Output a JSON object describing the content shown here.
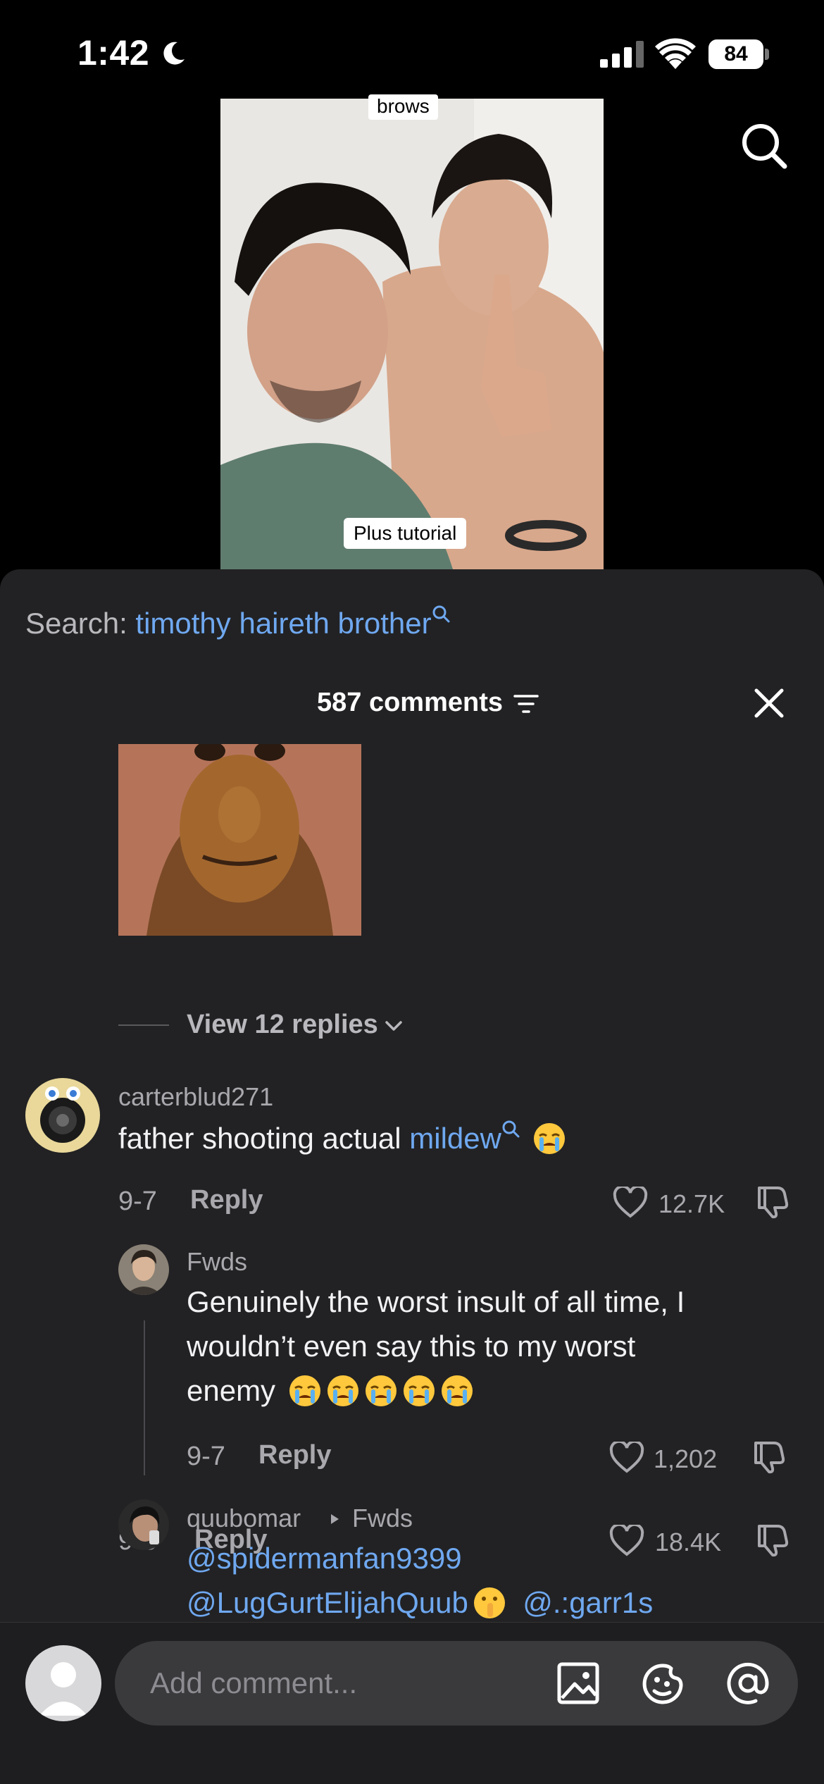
{
  "status_bar": {
    "time": "1:42",
    "battery": "84",
    "icons": [
      "moon-icon",
      "signal-icon",
      "wifi-icon",
      "battery-icon"
    ]
  },
  "video": {
    "caption_top": "brows",
    "caption_bottom": "Plus tutorial"
  },
  "comments_sheet": {
    "search_prefix": "Search:",
    "search_term": "timothy haireth brother",
    "count_label": "587 comments",
    "comments": [
      {
        "date": "9-6",
        "reply_label": "Reply",
        "likes": "18.4K",
        "view_replies": "View 12 replies"
      },
      {
        "username": "carterblud271",
        "text": "father shooting actual ",
        "mention": "mildew",
        "date": "9-7",
        "reply_label": "Reply",
        "likes": "12.7K",
        "replies": [
          {
            "username": "Fwds",
            "text_lines": [
              "Genuinely the worst insult of all time, I",
              "wouldn’t even say this to my worst",
              "enemy"
            ],
            "date": "9-7",
            "reply_label": "Reply",
            "likes": "1,202"
          },
          {
            "username": "quubomar",
            "reply_to": "Fwds",
            "mention_1": "@spidermanfan9399",
            "mention_2": "@LugGurtElijahQuub",
            "mention_3": "@.:garr1s"
          }
        ]
      }
    ]
  },
  "bottom_bar": {
    "placeholder": "Add comment..."
  },
  "colors": {
    "accent_link": "#6fa8f0",
    "sheet_bg": "#222224",
    "muted_text": "#a8a8ad"
  }
}
